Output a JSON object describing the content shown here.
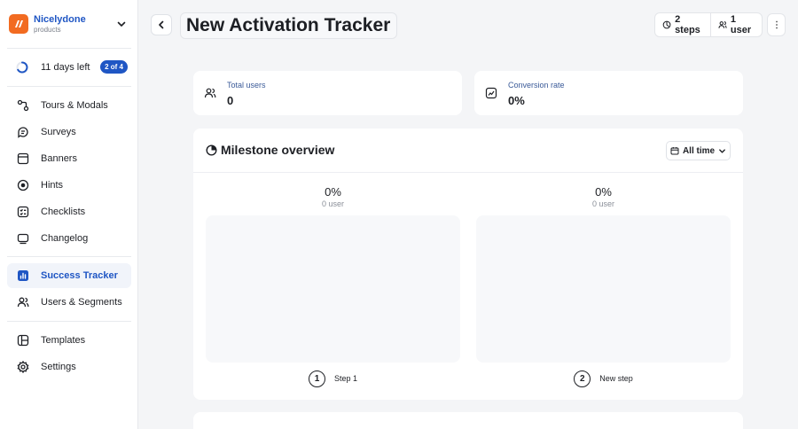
{
  "brand": {
    "name": "Nicelydone",
    "subtitle": "products",
    "logo_color": "#f26b21"
  },
  "trial": {
    "text": "11 days left",
    "badge": "2 of 4"
  },
  "sidebar": {
    "items": [
      {
        "label": "Tours & Modals",
        "icon": "tours-icon"
      },
      {
        "label": "Surveys",
        "icon": "survey-icon"
      },
      {
        "label": "Banners",
        "icon": "banner-icon"
      },
      {
        "label": "Hints",
        "icon": "hint-icon"
      },
      {
        "label": "Checklists",
        "icon": "checklist-icon"
      },
      {
        "label": "Changelog",
        "icon": "changelog-icon"
      },
      {
        "label": "Success Tracker",
        "icon": "chart-icon",
        "active": true
      },
      {
        "label": "Users & Segments",
        "icon": "users-icon"
      },
      {
        "label": "Templates",
        "icon": "template-icon"
      },
      {
        "label": "Settings",
        "icon": "gear-icon"
      }
    ]
  },
  "header": {
    "title": "New Activation Tracker",
    "steps": "2 steps",
    "users": "1 user"
  },
  "stats": [
    {
      "label": "Total users",
      "value": "0"
    },
    {
      "label": "Conversion rate",
      "value": "0%"
    }
  ],
  "milestones": {
    "title": "Milestone overview",
    "range": "All time",
    "steps": [
      {
        "number": "1",
        "label": "Step 1",
        "percent": "0%",
        "users": "0 user"
      },
      {
        "number": "2",
        "label": "New step",
        "percent": "0%",
        "users": "0 user"
      }
    ]
  },
  "colors": {
    "accent": "#1f56c4",
    "background": "#f4f5f7"
  }
}
